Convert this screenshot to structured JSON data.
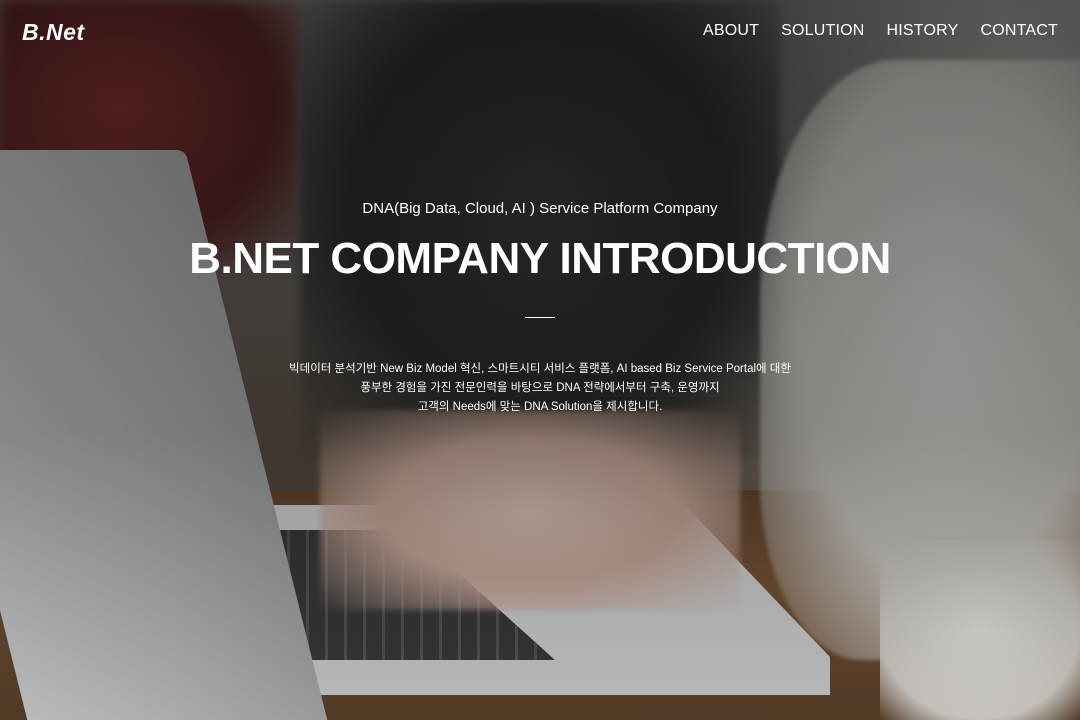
{
  "header": {
    "logo": "B.Net",
    "nav": [
      {
        "label": "ABOUT"
      },
      {
        "label": "SOLUTION"
      },
      {
        "label": "HISTORY"
      },
      {
        "label": "CONTACT"
      }
    ]
  },
  "hero": {
    "tagline": "DNA(Big Data, Cloud, AI ) Service Platform Company",
    "title": "B.NET COMPANY INTRODUCTION",
    "description": [
      "빅데이터 분석기반 New Biz Model 혁신, 스마트시티 서비스 플랫폼, AI based Biz Service Portal에 대한",
      "풍부한 경험을 가진 전문인력을 바탕으로 DNA 전략에서부터 구축, 운영까지",
      "고객의 Needs에 맞는 DNA Solution을 제시합니다."
    ],
    "background_image": "person typing on laptop at wooden table",
    "overlay_color": "#000000"
  },
  "colors": {
    "text": "#ffffff",
    "accent": "#ffffff"
  }
}
